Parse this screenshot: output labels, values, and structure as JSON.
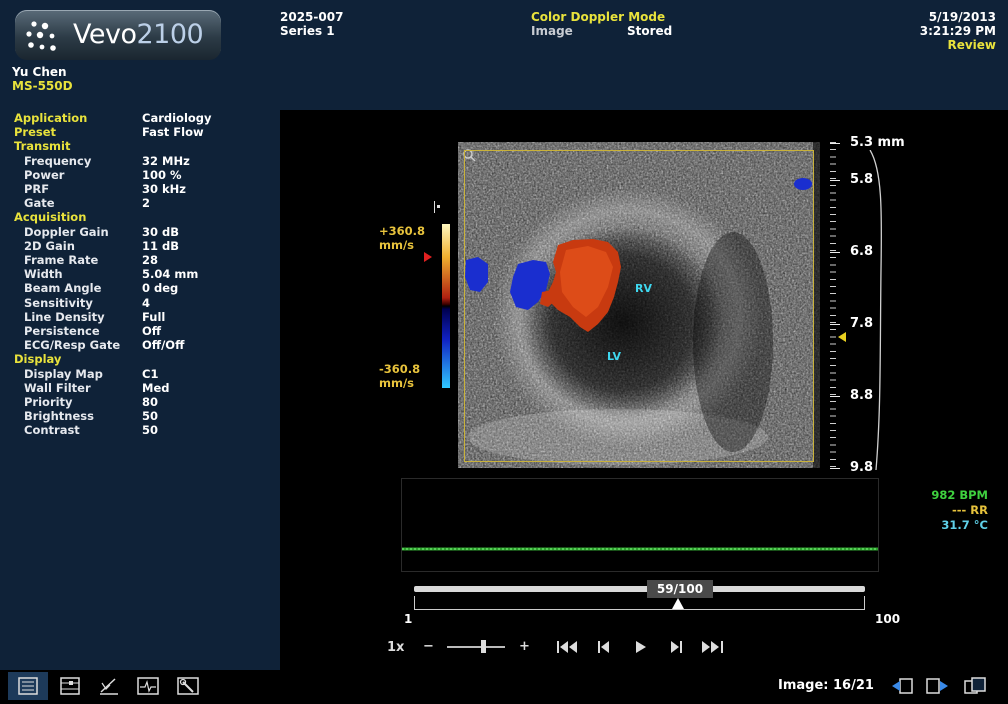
{
  "header": {
    "logo": {
      "brand": "Vevo",
      "model": "2100"
    },
    "operator": "Yu Chen",
    "transducer": "MS-550D",
    "study_id": "2025-007",
    "series": "Series 1",
    "mode": "Color Doppler Mode",
    "image_label": "Image",
    "image_status": "Stored",
    "date": "5/19/2013",
    "time": "3:21:29 PM",
    "review_link": "Review"
  },
  "params": [
    {
      "key": "Application",
      "value": "Cardiology",
      "type": "top"
    },
    {
      "key": "Preset",
      "value": "Fast Flow",
      "type": "top"
    },
    {
      "key": "Transmit",
      "value": "",
      "type": "section"
    },
    {
      "key": "Frequency",
      "value": "32 MHz",
      "type": "item"
    },
    {
      "key": "Power",
      "value": "100 %",
      "type": "item"
    },
    {
      "key": "PRF",
      "value": "30 kHz",
      "type": "item"
    },
    {
      "key": "Gate",
      "value": "2",
      "type": "item"
    },
    {
      "key": "Acquisition",
      "value": "",
      "type": "section"
    },
    {
      "key": "Doppler Gain",
      "value": "30 dB",
      "type": "item"
    },
    {
      "key": "2D Gain",
      "value": "11 dB",
      "type": "item"
    },
    {
      "key": "Frame Rate",
      "value": "28",
      "type": "item"
    },
    {
      "key": "Width",
      "value": "5.04 mm",
      "type": "item"
    },
    {
      "key": "Beam Angle",
      "value": "0 deg",
      "type": "item"
    },
    {
      "key": "Sensitivity",
      "value": "4",
      "type": "item"
    },
    {
      "key": "Line Density",
      "value": "Full",
      "type": "item"
    },
    {
      "key": "Persistence",
      "value": "Off",
      "type": "item"
    },
    {
      "key": "ECG/Resp Gate",
      "value": "Off/Off",
      "type": "item"
    },
    {
      "key": "Display",
      "value": "",
      "type": "section"
    },
    {
      "key": "Display Map",
      "value": "C1",
      "type": "item"
    },
    {
      "key": "Wall Filter",
      "value": "Med",
      "type": "item"
    },
    {
      "key": "Priority",
      "value": "80",
      "type": "item"
    },
    {
      "key": "Brightness",
      "value": "50",
      "type": "item"
    },
    {
      "key": "Contrast",
      "value": "50",
      "type": "item"
    }
  ],
  "colorbar": {
    "max_value": "+360.8",
    "max_unit": "mm/s",
    "min_value": "-360.8",
    "min_unit": "mm/s"
  },
  "image": {
    "labels": {
      "rv": "RV",
      "lv": "LV"
    },
    "depth_scale": [
      "5.3 mm",
      "5.8",
      "6.8",
      "7.8",
      "8.8",
      "9.8"
    ]
  },
  "physio": {
    "heart_rate": "982 BPM",
    "resp_rate": "--- RR",
    "temperature": "31.7 °C"
  },
  "timeline": {
    "current_label": "59/100",
    "start": "1",
    "end": "100",
    "position_fraction": 0.586
  },
  "playback": {
    "speed": "1x",
    "minus": "−",
    "plus": "+"
  },
  "footer": {
    "image_counter": "Image: 16/21"
  },
  "colors": {
    "accent_yellow": "#e8e23c",
    "panel_bg": "#0f2238",
    "cyan_label": "#3fd8f0",
    "hr_green": "#3fd13f",
    "rr_orange": "#e8c33c",
    "temp_cyan": "#5fd0e8"
  },
  "icons": [
    "parameters-icon",
    "measurement-tools-icon",
    "annotation-icon",
    "physio-icon",
    "settings-tools-icon",
    "previous-image-icon",
    "next-image-icon",
    "layout-icon"
  ]
}
